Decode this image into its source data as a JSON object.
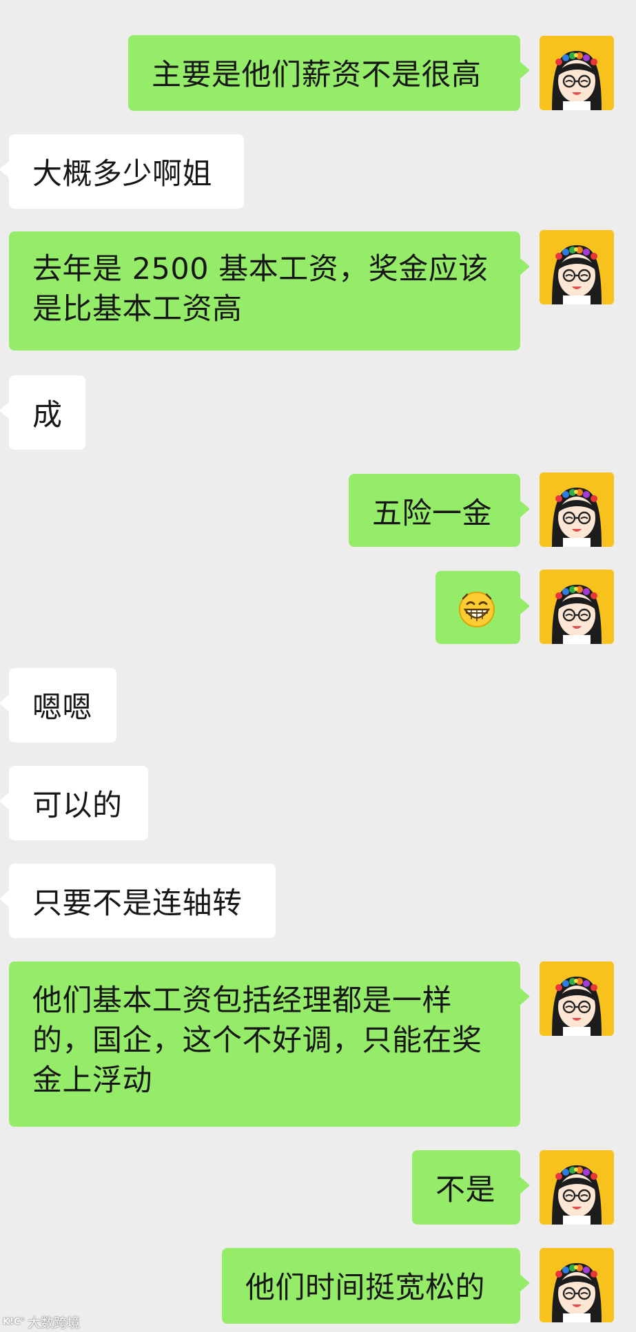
{
  "colors": {
    "background": "#ededed",
    "outgoing_bubble": "#95ec69",
    "incoming_bubble": "#ffffff",
    "avatar_bg": "#f7c21b"
  },
  "messages": [
    {
      "side": "out",
      "text": "主要是他们薪资不是很高"
    },
    {
      "side": "in",
      "text": "大概多少啊姐"
    },
    {
      "side": "out",
      "text": "去年是 2500 基本工资，奖金应该是比基本工资高"
    },
    {
      "side": "in",
      "text": "成"
    },
    {
      "side": "out",
      "text": "五险一金"
    },
    {
      "side": "out",
      "emoji": "grin-emoji"
    },
    {
      "side": "in",
      "text": "嗯嗯"
    },
    {
      "side": "in",
      "text": "可以的"
    },
    {
      "side": "in",
      "text": "只要不是连轴转"
    },
    {
      "side": "out",
      "text": "他们基本工资包括经理都是一样的，国企，这个不好调，只能在奖金上浮动"
    },
    {
      "side": "out",
      "text": "不是"
    },
    {
      "side": "out",
      "text": "他们时间挺宽松的"
    }
  ],
  "watermark": {
    "logo": "K!C°",
    "text": "大数跨境"
  }
}
